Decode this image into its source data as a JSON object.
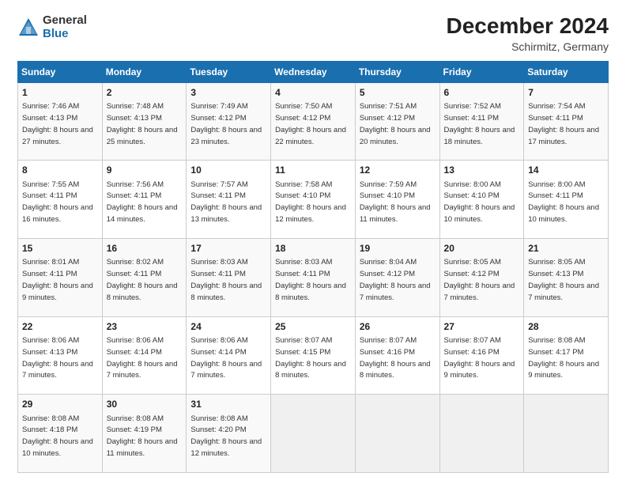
{
  "logo": {
    "general": "General",
    "blue": "Blue"
  },
  "title": "December 2024",
  "subtitle": "Schirmitz, Germany",
  "days_header": [
    "Sunday",
    "Monday",
    "Tuesday",
    "Wednesday",
    "Thursday",
    "Friday",
    "Saturday"
  ],
  "weeks": [
    [
      {
        "day": "1",
        "sunrise": "7:46 AM",
        "sunset": "4:13 PM",
        "daylight": "8 hours and 27 minutes."
      },
      {
        "day": "2",
        "sunrise": "7:48 AM",
        "sunset": "4:13 PM",
        "daylight": "8 hours and 25 minutes."
      },
      {
        "day": "3",
        "sunrise": "7:49 AM",
        "sunset": "4:12 PM",
        "daylight": "8 hours and 23 minutes."
      },
      {
        "day": "4",
        "sunrise": "7:50 AM",
        "sunset": "4:12 PM",
        "daylight": "8 hours and 22 minutes."
      },
      {
        "day": "5",
        "sunrise": "7:51 AM",
        "sunset": "4:12 PM",
        "daylight": "8 hours and 20 minutes."
      },
      {
        "day": "6",
        "sunrise": "7:52 AM",
        "sunset": "4:11 PM",
        "daylight": "8 hours and 18 minutes."
      },
      {
        "day": "7",
        "sunrise": "7:54 AM",
        "sunset": "4:11 PM",
        "daylight": "8 hours and 17 minutes."
      }
    ],
    [
      {
        "day": "8",
        "sunrise": "7:55 AM",
        "sunset": "4:11 PM",
        "daylight": "8 hours and 16 minutes."
      },
      {
        "day": "9",
        "sunrise": "7:56 AM",
        "sunset": "4:11 PM",
        "daylight": "8 hours and 14 minutes."
      },
      {
        "day": "10",
        "sunrise": "7:57 AM",
        "sunset": "4:11 PM",
        "daylight": "8 hours and 13 minutes."
      },
      {
        "day": "11",
        "sunrise": "7:58 AM",
        "sunset": "4:10 PM",
        "daylight": "8 hours and 12 minutes."
      },
      {
        "day": "12",
        "sunrise": "7:59 AM",
        "sunset": "4:10 PM",
        "daylight": "8 hours and 11 minutes."
      },
      {
        "day": "13",
        "sunrise": "8:00 AM",
        "sunset": "4:10 PM",
        "daylight": "8 hours and 10 minutes."
      },
      {
        "day": "14",
        "sunrise": "8:00 AM",
        "sunset": "4:11 PM",
        "daylight": "8 hours and 10 minutes."
      }
    ],
    [
      {
        "day": "15",
        "sunrise": "8:01 AM",
        "sunset": "4:11 PM",
        "daylight": "8 hours and 9 minutes."
      },
      {
        "day": "16",
        "sunrise": "8:02 AM",
        "sunset": "4:11 PM",
        "daylight": "8 hours and 8 minutes."
      },
      {
        "day": "17",
        "sunrise": "8:03 AM",
        "sunset": "4:11 PM",
        "daylight": "8 hours and 8 minutes."
      },
      {
        "day": "18",
        "sunrise": "8:03 AM",
        "sunset": "4:11 PM",
        "daylight": "8 hours and 8 minutes."
      },
      {
        "day": "19",
        "sunrise": "8:04 AM",
        "sunset": "4:12 PM",
        "daylight": "8 hours and 7 minutes."
      },
      {
        "day": "20",
        "sunrise": "8:05 AM",
        "sunset": "4:12 PM",
        "daylight": "8 hours and 7 minutes."
      },
      {
        "day": "21",
        "sunrise": "8:05 AM",
        "sunset": "4:13 PM",
        "daylight": "8 hours and 7 minutes."
      }
    ],
    [
      {
        "day": "22",
        "sunrise": "8:06 AM",
        "sunset": "4:13 PM",
        "daylight": "8 hours and 7 minutes."
      },
      {
        "day": "23",
        "sunrise": "8:06 AM",
        "sunset": "4:14 PM",
        "daylight": "8 hours and 7 minutes."
      },
      {
        "day": "24",
        "sunrise": "8:06 AM",
        "sunset": "4:14 PM",
        "daylight": "8 hours and 7 minutes."
      },
      {
        "day": "25",
        "sunrise": "8:07 AM",
        "sunset": "4:15 PM",
        "daylight": "8 hours and 8 minutes."
      },
      {
        "day": "26",
        "sunrise": "8:07 AM",
        "sunset": "4:16 PM",
        "daylight": "8 hours and 8 minutes."
      },
      {
        "day": "27",
        "sunrise": "8:07 AM",
        "sunset": "4:16 PM",
        "daylight": "8 hours and 9 minutes."
      },
      {
        "day": "28",
        "sunrise": "8:08 AM",
        "sunset": "4:17 PM",
        "daylight": "8 hours and 9 minutes."
      }
    ],
    [
      {
        "day": "29",
        "sunrise": "8:08 AM",
        "sunset": "4:18 PM",
        "daylight": "8 hours and 10 minutes."
      },
      {
        "day": "30",
        "sunrise": "8:08 AM",
        "sunset": "4:19 PM",
        "daylight": "8 hours and 11 minutes."
      },
      {
        "day": "31",
        "sunrise": "8:08 AM",
        "sunset": "4:20 PM",
        "daylight": "8 hours and 12 minutes."
      },
      null,
      null,
      null,
      null
    ]
  ]
}
